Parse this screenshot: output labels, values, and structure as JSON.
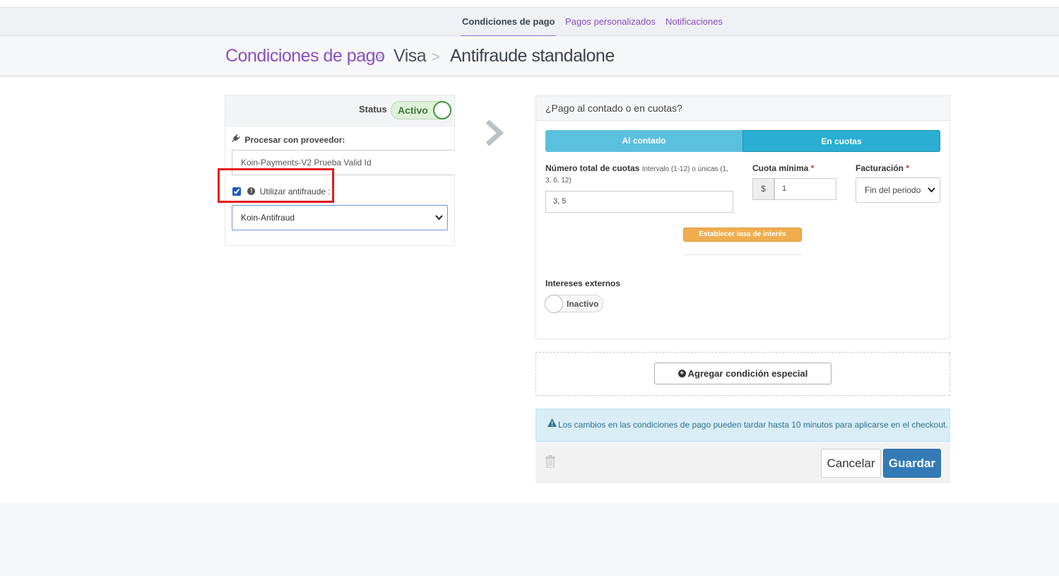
{
  "tabs": [
    {
      "label": "Condiciones de pago",
      "active": true
    },
    {
      "label": "Pagos personalizados",
      "active": false
    },
    {
      "label": "Notificaciones",
      "active": false
    }
  ],
  "breadcrumb": {
    "root": "Condiciones de pago",
    "middle": "Visa",
    "current": "Antifraude standalone",
    "separator": ">"
  },
  "left_panel": {
    "status_label": "Status",
    "status_value": "Activo",
    "provider_label": "Procesar con proveedor:",
    "provider_value": "Koin-Payments-V2 Prueba Valid Id",
    "antifraud_checked": true,
    "antifraud_label": "Utilizar antifraude :",
    "antifraud_selected": "Koin-Antifraud"
  },
  "right_panel": {
    "header": "¿Pago al contado o en cuotas?",
    "segment_left": "Al contado",
    "segment_right": "En cuotas",
    "installments_label": "Número total de cuotas",
    "installments_hint_a": "Intervalo (1-12) o únicas (1,",
    "installments_hint_b": "3, 6, 12)",
    "installments_value": "3, 5",
    "min_installment_label": "Cuota mínima",
    "currency_symbol": "$",
    "min_installment_value": "1",
    "billing_label": "Facturación",
    "billing_selected": "Fin del periodo",
    "required_mark": "*",
    "interest_button": "Establecer tasa de interés",
    "external_interest_label": "Intereses externos",
    "external_interest_value": "Inactivo"
  },
  "special_condition_button": "Agregar condición especial",
  "alert_text": "Los cambios en las condiciones de pago pueden tardar hasta 10 minutos para aplicarse en el checkout.",
  "footer": {
    "cancel": "Cancelar",
    "save": "Guardar"
  },
  "colors": {
    "accent_purple": "#8a4fbf",
    "active_green": "#3c763d",
    "segment_blue": "#5bc0de",
    "save_blue": "#337ab7",
    "highlight_red": "#e3161e",
    "orange": "#f0ad4e"
  },
  "icons": {
    "provider": "plug-icon",
    "antifraud_info": "info-circle-icon",
    "next": "chevron-right-icon",
    "plus": "plus-circle-icon",
    "warning": "warning-icon",
    "delete": "trash-icon"
  }
}
